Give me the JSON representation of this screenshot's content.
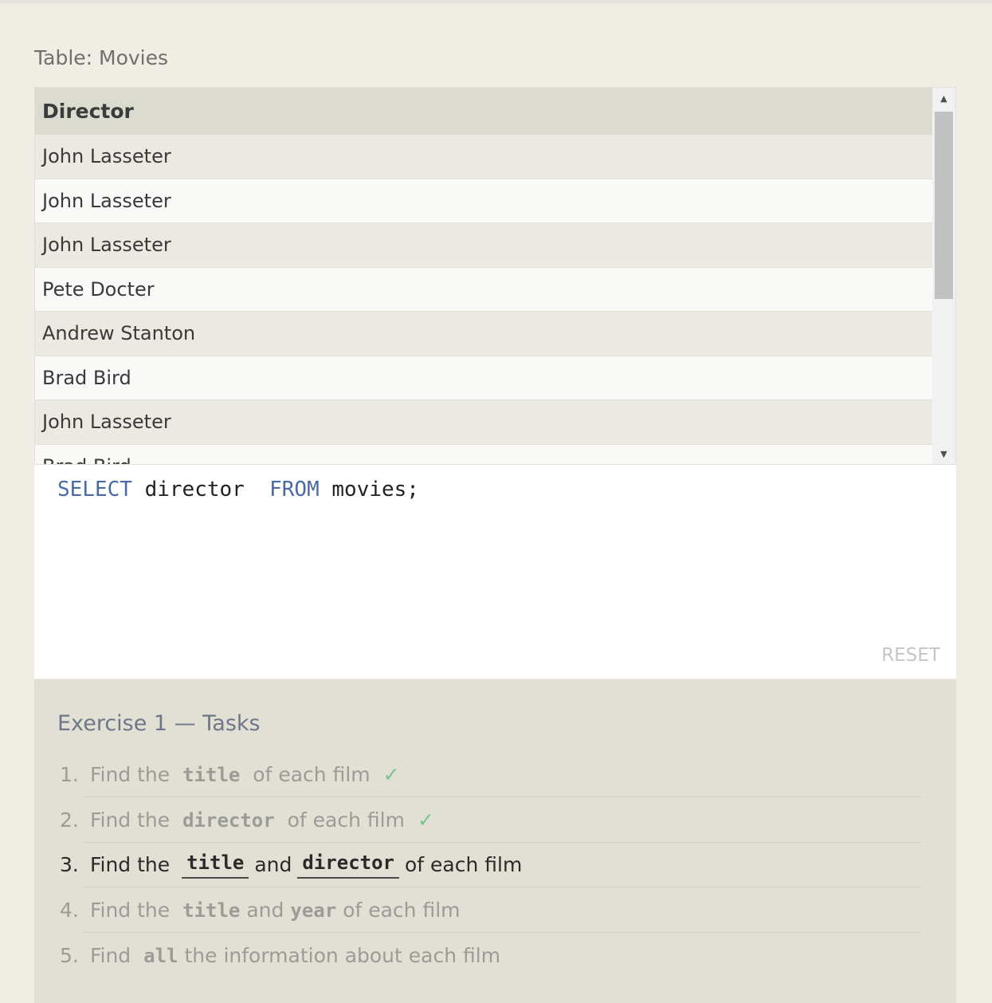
{
  "table": {
    "title": "Table: Movies",
    "header": "Director",
    "rows": [
      "John Lasseter",
      "John Lasseter",
      "John Lasseter",
      "Pete Docter",
      "Andrew Stanton",
      "Brad Bird",
      "John Lasseter",
      "Brad Bird"
    ]
  },
  "editor": {
    "kw_select": "SELECT",
    "col": " director  ",
    "kw_from": "FROM",
    "rest": " movies;",
    "reset_label": "RESET"
  },
  "tasks": {
    "title": "Exercise 1 — Tasks",
    "items": [
      {
        "num": "1.",
        "pre": " Find the ",
        "code1": "title",
        "mid": " of each film",
        "code2": "",
        "post": "",
        "status": "done",
        "check": "✓"
      },
      {
        "num": "2.",
        "pre": " Find the ",
        "code1": "director",
        "mid": " of each film",
        "code2": "",
        "post": "",
        "status": "done",
        "check": "✓"
      },
      {
        "num": "3.",
        "pre": " Find the ",
        "code1": "title",
        "mid": "and",
        "code2": "director",
        "post": "of each film",
        "status": "active",
        "check": ""
      },
      {
        "num": "4.",
        "pre": " Find the ",
        "code1": "title",
        "mid": "and",
        "code2": "year",
        "post": "of each film",
        "status": "pending",
        "check": ""
      },
      {
        "num": "5.",
        "pre": " Find ",
        "code1": "all",
        "mid": "the information about each film",
        "code2": "",
        "post": "",
        "status": "pending",
        "check": ""
      }
    ]
  },
  "colors": {
    "background": "#f0ede4",
    "keyword": "#4a6aa5",
    "check": "#7bc38a"
  }
}
